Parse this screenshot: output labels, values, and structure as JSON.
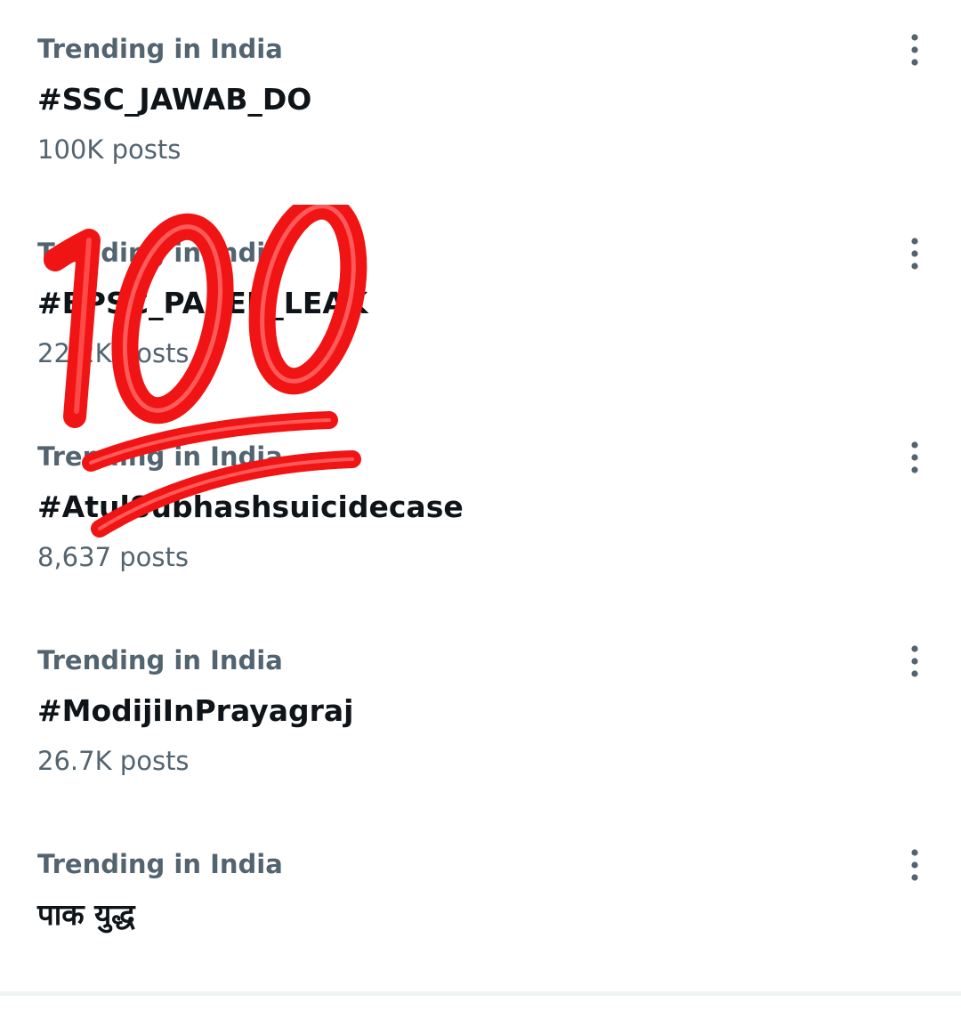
{
  "trends": [
    {
      "context": "Trending in India",
      "title": "#SSC_JAWAB_DO",
      "count": "100K posts",
      "more_icon": "more-vertical-icon"
    },
    {
      "context": "Trending in India",
      "title": "#BPSC_PAPER_LEAK",
      "count": "22.2K posts",
      "more_icon": "more-vertical-icon"
    },
    {
      "context": "Trending in India",
      "title": "#AtulSubhashsuicidecase",
      "count": "8,637 posts",
      "more_icon": "more-vertical-icon"
    },
    {
      "context": "Trending in India",
      "title": "#ModijiInPrayagraj",
      "count": "26.7K posts",
      "more_icon": "more-vertical-icon"
    },
    {
      "context": "Trending in India",
      "title": "पाक युद्ध",
      "count": "",
      "more_icon": "more-vertical-icon"
    }
  ],
  "overlay": {
    "emoji": "hundred-points-emoji",
    "color": "#ff1a1a"
  },
  "colors": {
    "primary_text": "#0f1419",
    "secondary_text": "#536471",
    "icon": "#536471",
    "divider": "#eff3f4"
  }
}
